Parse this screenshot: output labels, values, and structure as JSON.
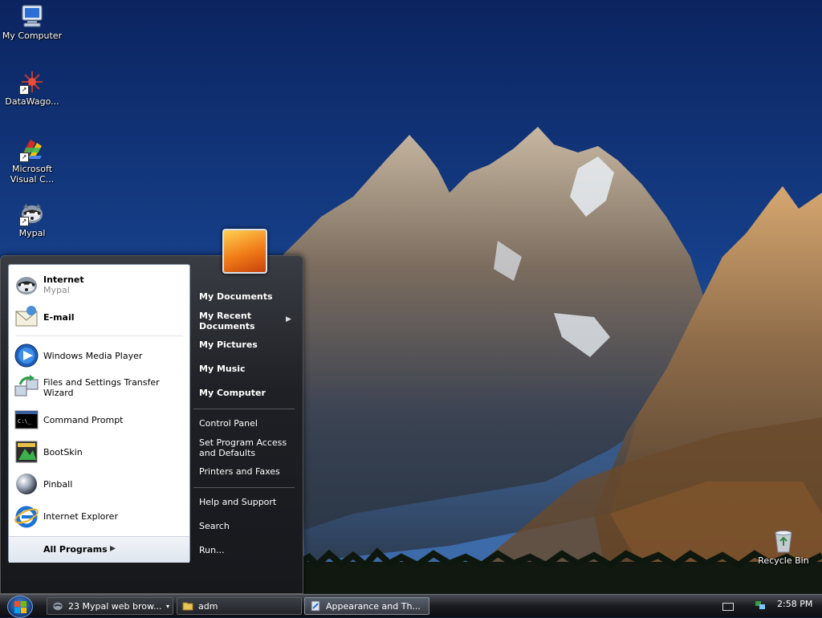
{
  "desktop": {
    "icons": [
      {
        "label": "My Computer",
        "icon": "computer-icon"
      },
      {
        "label": "DataWago...",
        "icon": "datawagon-icon"
      },
      {
        "label": "Microsoft Visual C...",
        "icon": "visual-studio-icon"
      },
      {
        "label": "Mypal",
        "icon": "mypal-icon"
      },
      {
        "label": "Recycle Bin",
        "icon": "recycle-bin-icon"
      }
    ]
  },
  "start_menu": {
    "pinned": [
      {
        "title": "Internet",
        "subtitle": "Mypal",
        "icon": "mypal-icon"
      },
      {
        "title": "E-mail",
        "icon": "email-icon"
      }
    ],
    "recent": [
      {
        "label": "Windows Media Player",
        "icon": "media-player-icon"
      },
      {
        "label": "Files and Settings Transfer Wizard",
        "icon": "transfer-wizard-icon"
      },
      {
        "label": "Command Prompt",
        "icon": "command-prompt-icon"
      },
      {
        "label": "BootSkin",
        "icon": "bootskin-icon"
      },
      {
        "label": "Pinball",
        "icon": "pinball-icon"
      },
      {
        "label": "Internet Explorer",
        "icon": "internet-explorer-icon"
      }
    ],
    "all_programs": "All Programs",
    "right": {
      "my_documents": "My Documents",
      "my_recent_documents": "My Recent Documents",
      "my_pictures": "My Pictures",
      "my_music": "My Music",
      "my_computer": "My Computer",
      "control_panel": "Control Panel",
      "set_program_access": "Set Program Access and Defaults",
      "printers_faxes": "Printers and Faxes",
      "help_support": "Help and Support",
      "search": "Search",
      "run": "Run..."
    }
  },
  "taskbar": {
    "buttons": [
      {
        "label": "23 Mypal web brow...",
        "icon": "mypal-icon"
      },
      {
        "label": "adm",
        "icon": "folder-icon"
      },
      {
        "label": "Appearance and Th...",
        "icon": "control-panel-icon"
      }
    ],
    "clock": "2:58 PM"
  },
  "colors": {
    "sky": "#0d2a66",
    "menu_bg": "#1e2025",
    "accent": "#4f8fd8"
  }
}
